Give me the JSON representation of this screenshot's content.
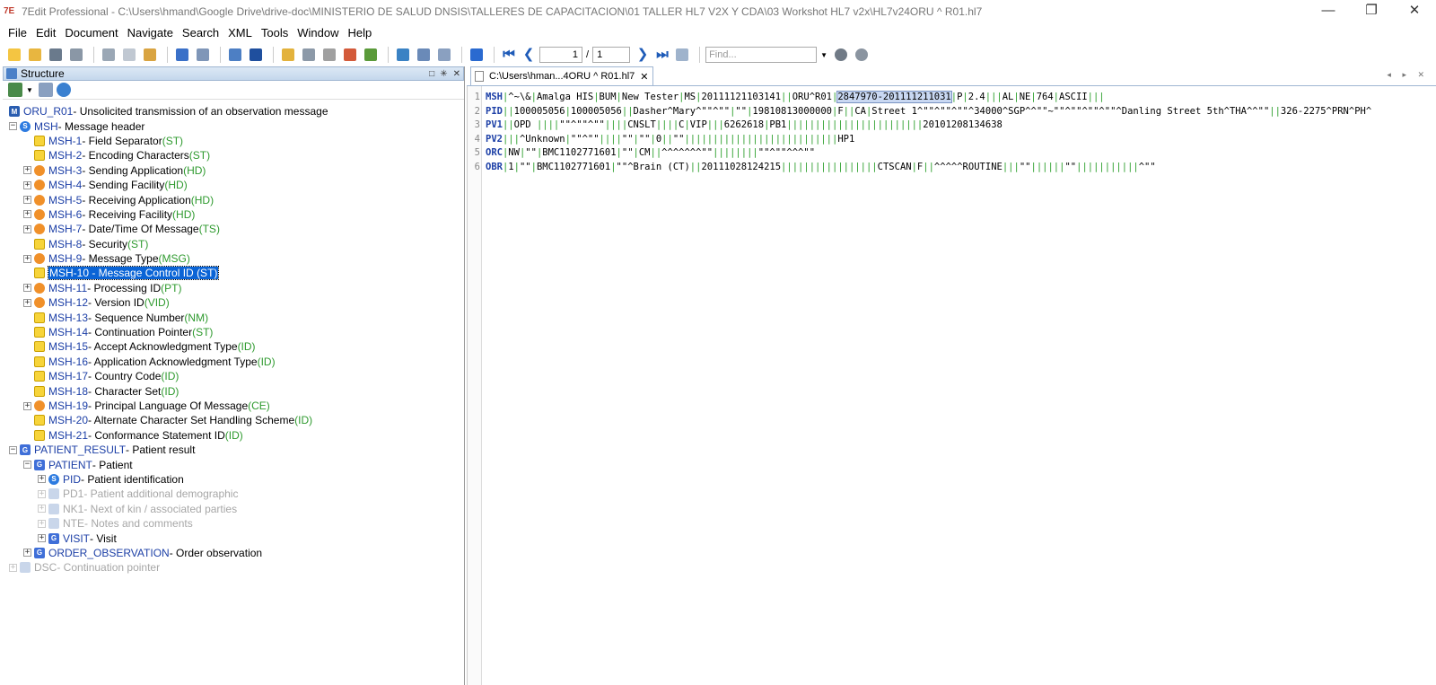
{
  "window": {
    "title": "7Edit Professional - C:\\Users\\hmand\\Google Drive\\drive-doc\\MINISTERIO DE SALUD DNSIS\\TALLERES DE CAPACITACION\\01 TALLER HL7 V2X Y CDA\\03 Workshot HL7 v2x\\HL7v24ORU ^ R01.hl7",
    "app_icon": "7E",
    "minimize": "—",
    "maximize": "❐",
    "close": "✕"
  },
  "menu": [
    "File",
    "Edit",
    "Document",
    "Navigate",
    "Search",
    "XML",
    "Tools",
    "Window",
    "Help"
  ],
  "toolbar": {
    "page_current": "1",
    "page_separator": "/",
    "page_total": "1",
    "find_placeholder": "Find..."
  },
  "structure": {
    "title": "Structure",
    "controls": [
      "□",
      "✳",
      "✕"
    ]
  },
  "tree": [
    {
      "name": "ORU_R01",
      "desc": " - Unsolicited transmission of an observation message",
      "type": "",
      "icon": "message-icon"
    },
    {
      "name": "MSH",
      "desc": " - Message header",
      "type": "",
      "icon": "segment-icon"
    },
    {
      "name": "MSH-1",
      "desc": " - Field Separator ",
      "type": "(ST)",
      "icon": "field-icon"
    },
    {
      "name": "MSH-2",
      "desc": " - Encoding Characters ",
      "type": "(ST)",
      "icon": "field-icon"
    },
    {
      "name": "MSH-3",
      "desc": " - Sending Application ",
      "type": "(HD)",
      "icon": "composite-icon"
    },
    {
      "name": "MSH-4",
      "desc": " - Sending Facility ",
      "type": "(HD)",
      "icon": "composite-icon"
    },
    {
      "name": "MSH-5",
      "desc": " - Receiving Application ",
      "type": "(HD)",
      "icon": "composite-icon"
    },
    {
      "name": "MSH-6",
      "desc": " - Receiving Facility ",
      "type": "(HD)",
      "icon": "composite-icon"
    },
    {
      "name": "MSH-7",
      "desc": " - Date/Time Of Message ",
      "type": "(TS)",
      "icon": "composite-icon"
    },
    {
      "name": "MSH-8",
      "desc": " - Security ",
      "type": "(ST)",
      "icon": "field-icon"
    },
    {
      "name": "MSH-9",
      "desc": " - Message Type ",
      "type": "(MSG)",
      "icon": "composite-icon"
    },
    {
      "name": "MSH-10",
      "desc": " - Message Control ID ",
      "type": "(ST)",
      "icon": "field-icon"
    },
    {
      "name": "MSH-11",
      "desc": " - Processing ID ",
      "type": "(PT)",
      "icon": "composite-icon"
    },
    {
      "name": "MSH-12",
      "desc": " - Version ID ",
      "type": "(VID)",
      "icon": "composite-icon"
    },
    {
      "name": "MSH-13",
      "desc": " - Sequence Number ",
      "type": "(NM)",
      "icon": "field-icon"
    },
    {
      "name": "MSH-14",
      "desc": " - Continuation Pointer ",
      "type": "(ST)",
      "icon": "field-icon"
    },
    {
      "name": "MSH-15",
      "desc": " - Accept Acknowledgment Type ",
      "type": "(ID)",
      "icon": "field-icon"
    },
    {
      "name": "MSH-16",
      "desc": " - Application Acknowledgment Type ",
      "type": "(ID)",
      "icon": "field-icon"
    },
    {
      "name": "MSH-17",
      "desc": " - Country Code ",
      "type": "(ID)",
      "icon": "field-icon"
    },
    {
      "name": "MSH-18",
      "desc": " - Character Set ",
      "type": "(ID)",
      "icon": "field-icon"
    },
    {
      "name": "MSH-19",
      "desc": " - Principal Language Of Message ",
      "type": "(CE)",
      "icon": "composite-icon"
    },
    {
      "name": "MSH-20",
      "desc": " - Alternate Character Set Handling Scheme ",
      "type": "(ID)",
      "icon": "field-icon"
    },
    {
      "name": "MSH-21",
      "desc": " - Conformance Statement ID ",
      "type": "(ID)",
      "icon": "field-icon"
    },
    {
      "name": "PATIENT_RESULT",
      "desc": " - Patient result",
      "type": "",
      "icon": "group-icon"
    },
    {
      "name": "PATIENT",
      "desc": " - Patient",
      "type": "",
      "icon": "group-icon"
    },
    {
      "name": "PID",
      "desc": " - Patient identification",
      "type": "",
      "icon": "segment-icon"
    },
    {
      "name": "PD1",
      "desc": " - Patient additional demographic",
      "type": "",
      "icon": "segment-disabled-icon"
    },
    {
      "name": "NK1",
      "desc": " - Next of kin / associated parties",
      "type": "",
      "icon": "segment-disabled-icon"
    },
    {
      "name": "NTE",
      "desc": " - Notes and comments",
      "type": "",
      "icon": "segment-disabled-icon"
    },
    {
      "name": "VISIT",
      "desc": " - Visit",
      "type": "",
      "icon": "group-icon"
    },
    {
      "name": "ORDER_OBSERVATION",
      "desc": " - Order observation",
      "type": "",
      "icon": "group-icon"
    },
    {
      "name": "DSC",
      "desc": " - Continuation pointer",
      "type": "",
      "icon": "segment-disabled-icon"
    }
  ],
  "editor": {
    "tab_label": "C:\\Users\\hman...4ORU ^ R01.hl7",
    "tab_close": "✕",
    "tab_arrows": "◂ ▸ ✕",
    "lines": [
      {
        "no": "1",
        "seg": "MSH",
        "rest": "|^~\\&|Amalga HIS|BUM|New Tester|MS|20111121103141||ORU^R01|",
        "highlight": "2847970-201111211031",
        "tail": "|P|2.4|||AL|NE|764|ASCII|||"
      },
      {
        "no": "2",
        "seg": "PID",
        "rest": "||100005056|100005056||Dasher^Mary^\"\"^\"\"|\"\"|19810813000000|F||CA|Street 1^\"\"^\"\"^\"\"^34000^SGP^^\"\"~\"\"^\"\"^\"\"^\"\"^Danling Street 5th^THA^^\"\"||326-2275^PRN^PH^",
        "highlight": "",
        "tail": ""
      },
      {
        "no": "3",
        "seg": "PV1",
        "rest": "||OPD   ||||\"\"^\"\"^\"\"||||CNSLT||||C|VIP|||6262618|PB1||||||||||||||||||||||||20101208134638",
        "highlight": "",
        "tail": ""
      },
      {
        "no": "4",
        "seg": "PV2",
        "rest": "|||^Unknown|\"\"^\"\"||||\"\"|\"\"|0||\"\"|||||||||||||||||||||||||||HP1",
        "highlight": "",
        "tail": ""
      },
      {
        "no": "5",
        "seg": "ORC",
        "rest": "|NW|\"\"|BMC1102771601|\"\"|CM||^^^^^^^\"\"||||||||\"\"^\"\"^^^\"\"",
        "highlight": "",
        "tail": ""
      },
      {
        "no": "6",
        "seg": "OBR",
        "rest": "|1|\"\"|BMC1102771601|\"\"^Brain (CT)||20111028124215|||||||||||||||||CTSCAN|F||^^^^^ROUTINE|||\"\"||||||\"\"|||||||||||^\"\"",
        "highlight": "",
        "tail": ""
      }
    ]
  }
}
